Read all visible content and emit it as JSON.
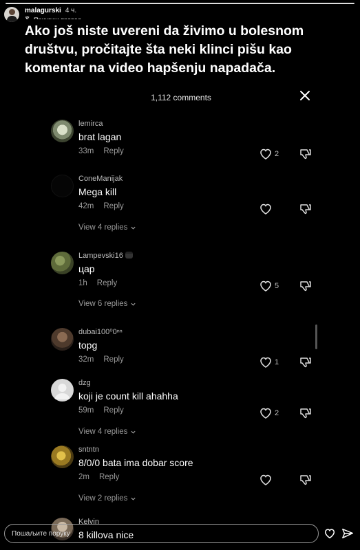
{
  "story": {
    "username": "malagurski",
    "time": "4 ч.",
    "translate_label": "Прикажи превод"
  },
  "caption": "Ako još niste uvereni da živimo u bolesnom društvu, pročitajte šta neki klinci pišu kao komentar na video hapšenju napadača.",
  "comments_panel": {
    "count_label": "1,112 comments",
    "reply_label": "Reply",
    "comments": [
      {
        "username": "lemirca",
        "text": "brat lagan",
        "time": "33m",
        "likes": "2",
        "view_replies": ""
      },
      {
        "username": "ConeManijak",
        "text": "Mega kill",
        "time": "42m",
        "likes": "",
        "view_replies": "View 4 replies"
      },
      {
        "username": "Lampevski16",
        "text": "цар",
        "time": "1h",
        "likes": "5",
        "view_replies": "View 6 replies"
      },
      {
        "username": "dubai100⁰0ⁿⁿ",
        "text": "topg",
        "time": "32m",
        "likes": "1",
        "view_replies": ""
      },
      {
        "username": "dzg",
        "text": "koji je count kill ahahha",
        "time": "59m",
        "likes": "2",
        "view_replies": "View 4 replies"
      },
      {
        "username": "sntntn",
        "text": "8/0/0 bata ima dobar score",
        "time": "2m",
        "likes": "",
        "view_replies": "View 2 replies"
      },
      {
        "username": "Kelvin",
        "text": "8 killova nice",
        "time": "",
        "likes": "",
        "view_replies": ""
      }
    ]
  },
  "footer": {
    "message_placeholder": "Пошаљите поруку"
  },
  "colors": {
    "background": "#000000",
    "muted_text": "#9a9a9a",
    "username_text": "#bdbdbd"
  }
}
